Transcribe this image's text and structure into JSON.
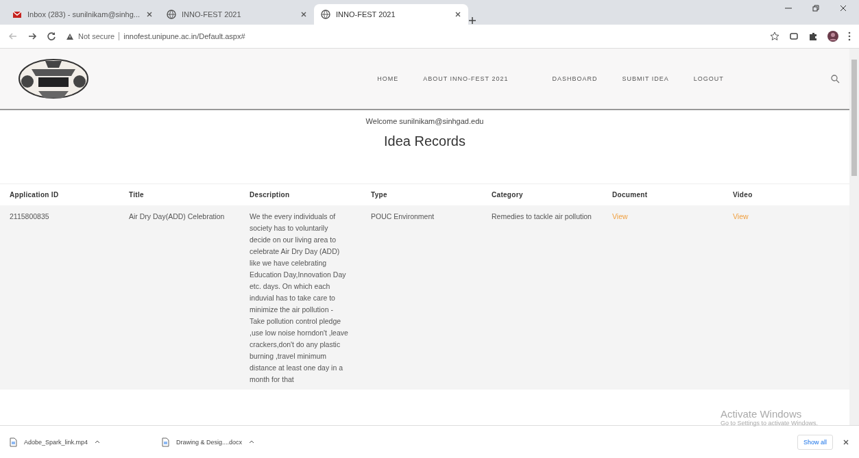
{
  "browser": {
    "tabs": [
      {
        "kind": "mail",
        "title": "Inbox (283) - sunilnikam@sinhg...",
        "selected": false
      },
      {
        "kind": "site",
        "title": "INNO-FEST 2021",
        "selected": false
      },
      {
        "kind": "site",
        "title": "INNO-FEST 2021",
        "selected": true
      }
    ],
    "security": "Not secure",
    "url": "innofest.unipune.ac.in/Default.aspx#"
  },
  "nav": [
    "HOME",
    "ABOUT INNO-FEST 2021",
    "DASHBOARD",
    "SUBMIT IDEA",
    "LOGOUT"
  ],
  "welcome": "Welcome sunilnikam@sinhgad.edu",
  "heading": "Idea Records",
  "table": {
    "columns": [
      "Application ID",
      "Title",
      "Description",
      "Type",
      "Category",
      "Document",
      "Video"
    ],
    "rows": [
      {
        "application_id": "2115800835",
        "title": "Air Dry Day(ADD) Celebration",
        "description": "We the every individuals of society has to voluntarily decide on our living area to celebrate Air Dry Day (ADD) like we have celebrating Education Day,Innovation Day etc. days. On which each induvial has to take care to minimize the air pollution - Take pollution control pledge ,use low noise horndon't ,leave crackers,don't do any plastic burning ,travel minimum distance at least one day in a month for that",
        "type": "POUC Environment",
        "category": "Remedies to tackle air pollution",
        "document": "View",
        "video": "View"
      }
    ]
  },
  "downloads": [
    {
      "name": "Adobe_Spark_link.mp4"
    },
    {
      "name": "Drawing & Desig....docx"
    }
  ],
  "show_all": "Show all",
  "activation": {
    "title": "Activate Windows",
    "hint": "Go to Settings to activate Windows."
  }
}
